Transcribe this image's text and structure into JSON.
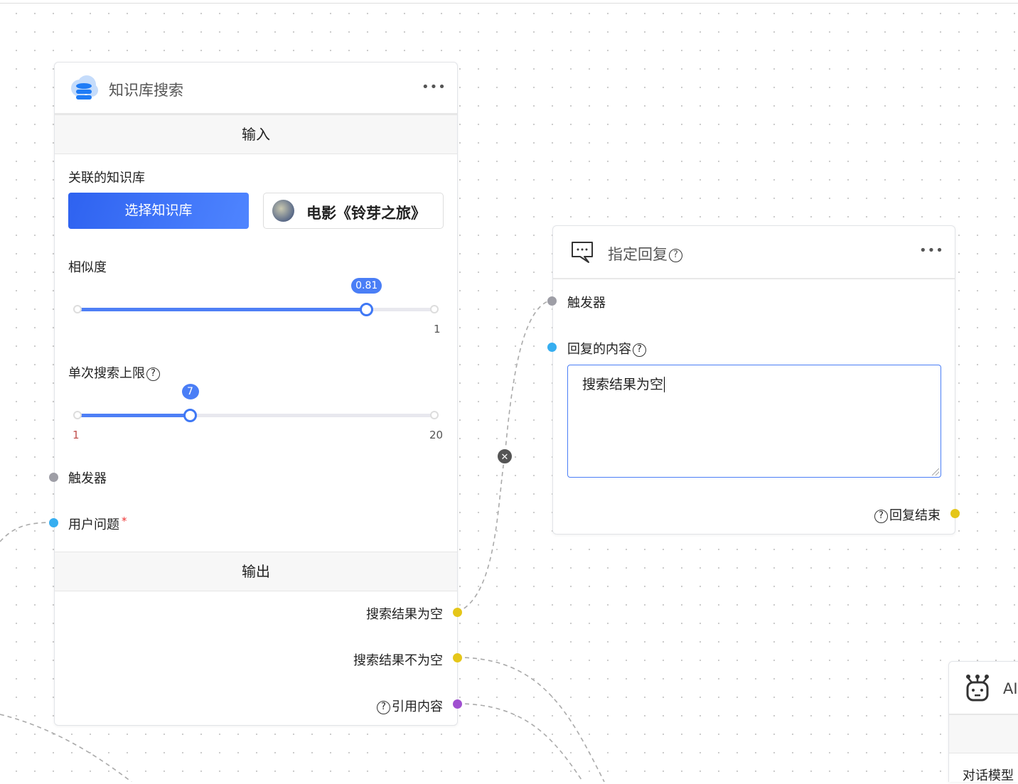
{
  "kb_node": {
    "title": "知识库搜索",
    "more": "•••",
    "input_section": "输入",
    "linked_kb_label": "关联的知识库",
    "select_kb_button": "选择知识库",
    "selected_kb": "电影《铃芽之旅》",
    "similarity": {
      "label": "相似度",
      "value": 0.81,
      "value_label": "0.81",
      "min": 0,
      "max": 1,
      "max_label": "1"
    },
    "max_results": {
      "label": "单次搜索上限",
      "value": 7,
      "value_label": "7",
      "min": 1,
      "max": 20,
      "min_label": "1",
      "max_label": "20"
    },
    "trigger": "触发器",
    "user_question": "用户问题",
    "required_mark": "*",
    "output_section": "输出",
    "outputs": [
      "搜索结果为空",
      "搜索结果不为空",
      "引用内容"
    ]
  },
  "reply_node": {
    "title": "指定回复",
    "more": "•••",
    "trigger": "触发器",
    "content_label": "回复的内容",
    "content_value": "搜索结果为空",
    "reply_end": "回复结束"
  },
  "ai_node": {
    "title": "AI",
    "model_label": "对话模型"
  },
  "help_glyph": "?",
  "delete_edge_glyph": "✕",
  "colors": {
    "accent": "#3f78f5",
    "trigger_handle": "#9e9ea6",
    "input_handle": "#36aef0",
    "output_handle": "#e5c619",
    "quote_handle": "#a050d0"
  }
}
